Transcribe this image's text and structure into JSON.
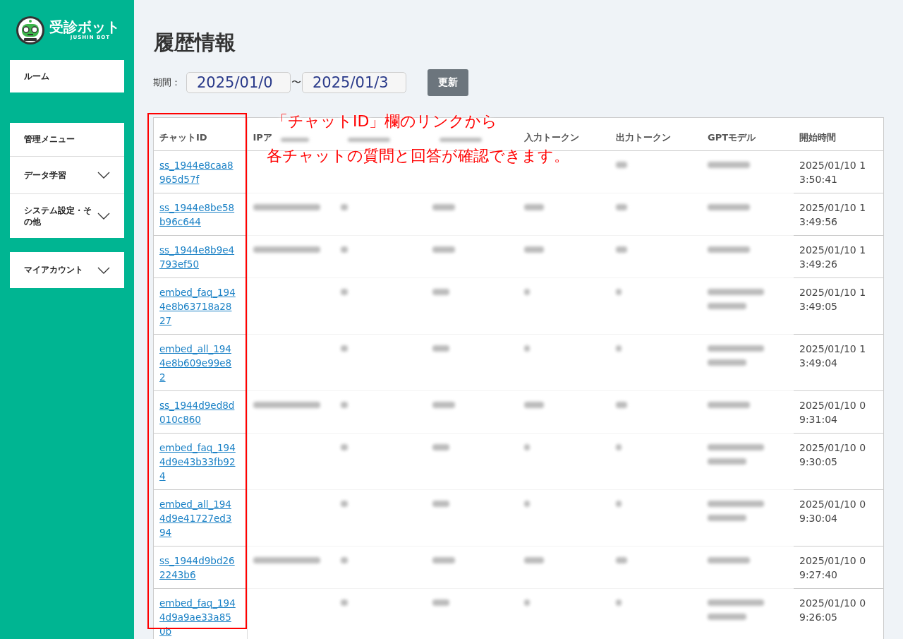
{
  "logo": {
    "name": "受診ボット",
    "sub": "JUSHIN BOT"
  },
  "sidebar": {
    "groups": [
      {
        "items": [
          {
            "label": "ルーム",
            "expandable": false
          }
        ]
      },
      {
        "items": [
          {
            "label": "管理メニュー",
            "expandable": false
          },
          {
            "label": "データ学習",
            "expandable": true
          },
          {
            "label": "システム設定・その他",
            "expandable": true
          }
        ]
      },
      {
        "items": [
          {
            "label": "マイアカウント",
            "expandable": true
          }
        ]
      }
    ]
  },
  "page": {
    "title": "履歴情報",
    "period_label": "期間：",
    "from": "2025/01/0",
    "separator": "〜",
    "to": "2025/01/3",
    "button": "更新"
  },
  "table": {
    "columns": [
      {
        "kind": "text",
        "label": "チャットID"
      },
      {
        "kind": "partial",
        "label": "IPア"
      },
      {
        "kind": "blurred"
      },
      {
        "kind": "blurred"
      },
      {
        "kind": "text",
        "label": "入力トークン"
      },
      {
        "kind": "text",
        "label": "出力トークン"
      },
      {
        "kind": "text",
        "label": "GPTモデル"
      },
      {
        "kind": "text",
        "label": "開始時間"
      }
    ],
    "rows": [
      {
        "chat_id": "ss_1944e8caa8965d57f",
        "kind": "covered",
        "start_time": "2025/01/10 13:50:41"
      },
      {
        "chat_id": "ss_1944e8be58b96c644",
        "kind": "chat",
        "start_time": "2025/01/10 13:49:56"
      },
      {
        "chat_id": "ss_1944e8b9e4793ef50",
        "kind": "chat",
        "start_time": "2025/01/10 13:49:26"
      },
      {
        "chat_id": "embed_faq_1944e8b63718a2827",
        "kind": "embed",
        "start_time": "2025/01/10 13:49:05"
      },
      {
        "chat_id": "embed_all_1944e8b609e99e82",
        "kind": "embed",
        "start_time": "2025/01/10 13:49:04"
      },
      {
        "chat_id": "ss_1944d9ed8d010c860",
        "kind": "chat",
        "start_time": "2025/01/10 09:31:04"
      },
      {
        "chat_id": "embed_faq_1944d9e43b33fb924",
        "kind": "embed",
        "start_time": "2025/01/10 09:30:05"
      },
      {
        "chat_id": "embed_all_1944d9e41727ed394",
        "kind": "embed",
        "start_time": "2025/01/10 09:30:04"
      },
      {
        "chat_id": "ss_1944d9bd262243b6",
        "kind": "chat",
        "start_time": "2025/01/10 09:27:40"
      },
      {
        "chat_id": "embed_faq_1944d9a9ae33a850b",
        "kind": "embed",
        "start_time": "2025/01/10 09:26:05"
      }
    ]
  },
  "annotation": {
    "lines": [
      "「チャットID」欄のリンクから",
      "各チャットの質問と回答が確認できます。"
    ]
  }
}
